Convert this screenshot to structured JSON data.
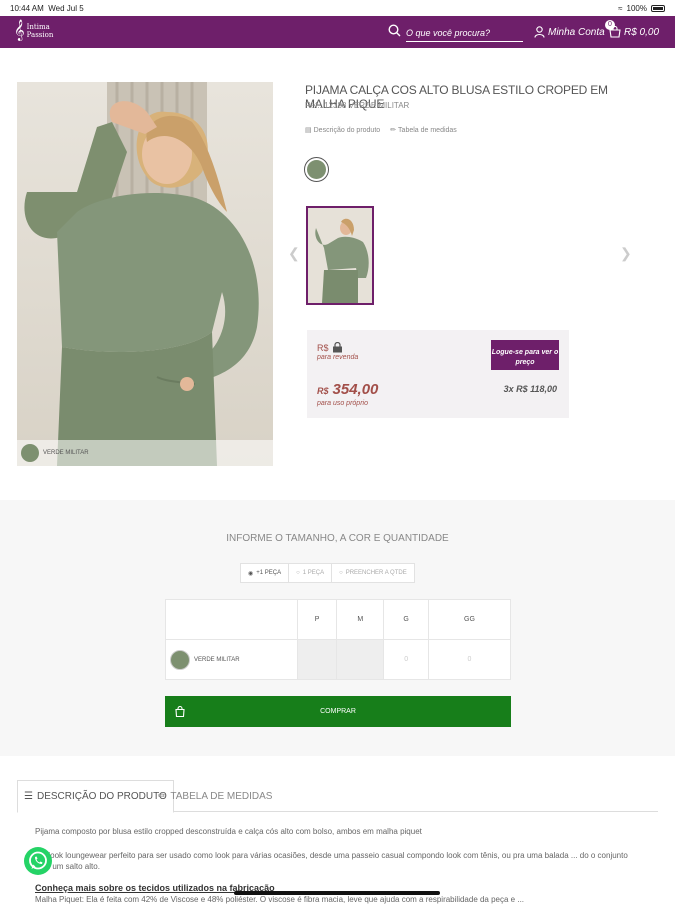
{
  "status_bar": {
    "time": "10:44 AM",
    "date": "Wed Jul 5",
    "battery": "100%"
  },
  "header": {
    "logo_line1": "Intima",
    "logo_line2": "Passion",
    "search_placeholder": "O que você procura?",
    "account_label": "Minha Conta",
    "cart_count": "0",
    "cart_total": "R$ 0,00",
    "brand_color": "#6e1f6a"
  },
  "product": {
    "title": "PIJAMA CALÇA COS ALTO BLUSA ESTILO CROPED EM MALHA PIQUE",
    "ref": "Ref.: 12388 VERDE MILITAR",
    "link_description": "Descrição do produto",
    "link_sizes": "Tabela de medidas",
    "image_color_label": "VERDE MILITAR",
    "swatch_color": "#7d9070"
  },
  "price_box": {
    "currency": "R$",
    "resale_label": "para revenda",
    "login_button": "Logue-se para ver o preço",
    "price_currency": "R$",
    "price_value": "354,00",
    "own_use_label": "para uso próprio",
    "installments": "3x R$ 118,00"
  },
  "size_section": {
    "title": "INFORME O TAMANHO, A COR E QUANTIDADE",
    "tabs": [
      "+1 PEÇA",
      "1 PEÇA",
      "PREENCHER A QTDE"
    ],
    "sizes": [
      "P",
      "M",
      "G",
      "GG"
    ],
    "row_color": "VERDE MILITAR",
    "row_values": [
      "",
      "",
      "0",
      "0"
    ],
    "buy_button": "COMPRAR",
    "buy_color": "#177e1a"
  },
  "details": {
    "tab_description": "DESCRIÇÃO DO PRODUTO",
    "tab_sizes": "TABELA DE MEDIDAS",
    "line1": "Pijama composto por blusa estilo cropped desconstruída e calça cós alto com bolso, ambos em malha piquet",
    "line2": "um look loungewear perfeito para ser usado como look para várias ocasiões, desde uma passeio casual compondo look com tênis, ou pra uma balada ... do o conjunto com um salto alto.",
    "line3": "Conheça mais sobre os tecidos utilizados na fabricação",
    "line4": "Malha Piquet: Ela é feita com 42% de Viscose e 48% poliéster. O viscose é fibra macia, leve que ajuda com a respirabilidade da peça e ..."
  }
}
